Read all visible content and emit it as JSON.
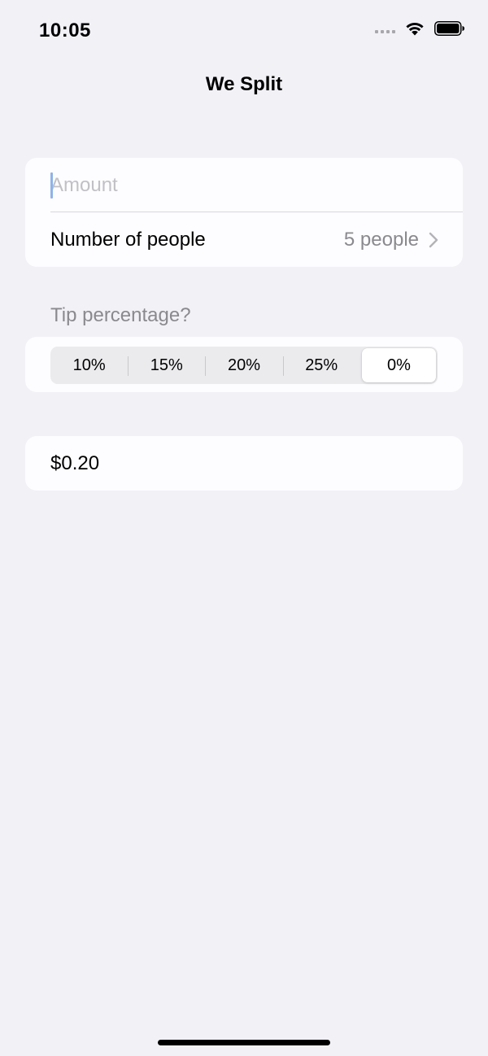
{
  "status_bar": {
    "time": "10:05",
    "icons": [
      "cellular-signal-icon",
      "wifi-icon",
      "battery-icon"
    ]
  },
  "nav": {
    "title": "We Split"
  },
  "form": {
    "amount": {
      "value": "",
      "placeholder": "Amount"
    },
    "people": {
      "label": "Number of people",
      "value": "5 people"
    }
  },
  "tip": {
    "header": "Tip percentage?",
    "options": [
      "10%",
      "15%",
      "20%",
      "25%",
      "0%"
    ],
    "selected": "0%"
  },
  "total": {
    "value": "$0.20"
  },
  "colors": {
    "background": "#f2f1f6",
    "card": "#fdfcff",
    "secondary_text": "#8a8a8e",
    "placeholder": "#c1c1c5",
    "cursor": "#8fb3e8"
  }
}
